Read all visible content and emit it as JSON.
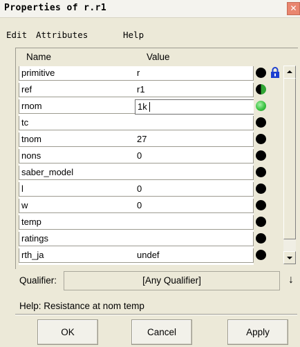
{
  "window": {
    "title": "Properties of r.r1",
    "close_glyph": "✕"
  },
  "menu": [
    "Edit",
    "Attributes",
    "Help"
  ],
  "table": {
    "headers": {
      "name": "Name",
      "value": "Value"
    },
    "rows": [
      {
        "name": "primitive",
        "value": "r",
        "indicator": "black"
      },
      {
        "name": "ref",
        "value": "r1",
        "indicator": "half-green"
      },
      {
        "name": "rnom",
        "value": "1k",
        "indicator": "green",
        "editing": true
      },
      {
        "name": "tc",
        "value": "",
        "indicator": "black"
      },
      {
        "name": "tnom",
        "value": "27",
        "indicator": "black"
      },
      {
        "name": "nons",
        "value": "0",
        "indicator": "black"
      },
      {
        "name": "saber_model",
        "value": "",
        "indicator": "black"
      },
      {
        "name": "l",
        "value": "0",
        "indicator": "black"
      },
      {
        "name": "w",
        "value": "0",
        "indicator": "black"
      },
      {
        "name": "temp",
        "value": "",
        "indicator": "black"
      },
      {
        "name": "ratings",
        "value": "",
        "indicator": "black"
      },
      {
        "name": "rth_ja",
        "value": "undef",
        "indicator": "black"
      }
    ]
  },
  "icons": {
    "lock": "lock-icon",
    "scroll_up": "scroll-up-arrow-icon",
    "scroll_down": "scroll-down-arrow-icon",
    "qualifier_arrow": "down-arrow-icon"
  },
  "qualifier": {
    "label": "Qualifier:",
    "value": "[Any Qualifier]",
    "arrow_glyph": "↓"
  },
  "help": {
    "text": "Help:  Resistance at nom temp"
  },
  "buttons": {
    "ok": "OK",
    "cancel": "Cancel",
    "apply": "Apply"
  },
  "colors": {
    "indicator_black": "#000000",
    "indicator_green": "#3cc443",
    "lock_blue": "#1c3fd1",
    "close_red": "#e9866f"
  }
}
